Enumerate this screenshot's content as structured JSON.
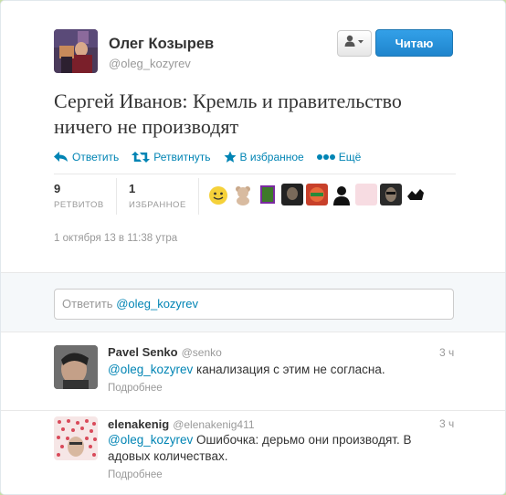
{
  "author": {
    "fullname": "Олег Козырев",
    "username": "@oleg_kozyrev"
  },
  "header": {
    "follow_label": "Читаю",
    "user_menu_icon": "user-icon"
  },
  "tweet": {
    "text": "Сергей Иванов: Кремль и правительство ничего не производят",
    "date": "1 октября 13 в 11:38 утра"
  },
  "actions": {
    "reply": "Ответить",
    "retweet": "Ретвитнуть",
    "favorite": "В избранное",
    "more": "Ещё"
  },
  "stats": {
    "retweets_count": "9",
    "retweets_label": "РЕТВИТОВ",
    "favorites_count": "1",
    "favorites_label": "ИЗБРАННОЕ"
  },
  "reply_box": {
    "prefix": "Ответить ",
    "mention": "@oleg_kozyrev"
  },
  "replies": [
    {
      "name": "Pavel Senko",
      "handle": "@senko",
      "time": "3 ч",
      "mention": "@oleg_kozyrev",
      "text": " канализация с этим не согласна.",
      "more": "Подробнее"
    },
    {
      "name": "elenakenig",
      "handle": "@elenakenig411",
      "time": "3 ч",
      "mention": "@oleg_kozyrev",
      "text": " Ошибочка: дерьмо они производят. В адовых количествах.",
      "more": "Подробнее"
    }
  ],
  "colors": {
    "link": "#0084b4",
    "follow_button": "#2b95e0",
    "page_bg": "#c7dfa7"
  }
}
